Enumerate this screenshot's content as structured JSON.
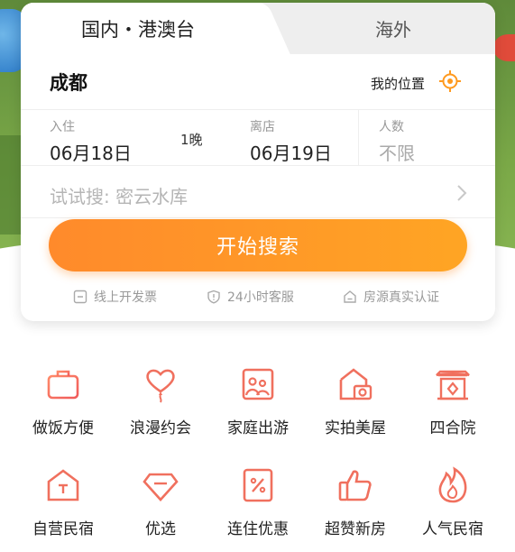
{
  "tabs": {
    "domestic": "国内・港澳台",
    "overseas": "海外"
  },
  "location": {
    "city": "成都",
    "my_location": "我的位置"
  },
  "dates": {
    "checkin_label": "入住",
    "checkin_value": "06月18日",
    "nights": "1晚",
    "checkout_label": "离店",
    "checkout_value": "06月19日",
    "guests_label": "人数",
    "guests_value": "不限"
  },
  "keyword": {
    "placeholder": "试试搜: 密云水库"
  },
  "search_button": "开始搜索",
  "features": [
    "线上开发票",
    "24小时客服",
    "房源真实认证"
  ],
  "categories": [
    {
      "label": "做饭方便",
      "icon": "cooking-pot-icon"
    },
    {
      "label": "浪漫约会",
      "icon": "heart-balloon-icon"
    },
    {
      "label": "家庭出游",
      "icon": "family-photo-icon"
    },
    {
      "label": "实拍美屋",
      "icon": "house-camera-icon"
    },
    {
      "label": "四合院",
      "icon": "courtyard-gate-icon"
    },
    {
      "label": "自营民宿",
      "icon": "self-run-house-icon"
    },
    {
      "label": "优选",
      "icon": "diamond-icon"
    },
    {
      "label": "连住优惠",
      "icon": "discount-coupon-icon"
    },
    {
      "label": "超赞新房",
      "icon": "thumbs-up-icon"
    },
    {
      "label": "人气民宿",
      "icon": "flame-icon"
    }
  ],
  "colors": {
    "accent": "#ff8a2b",
    "accent_end": "#ffa524",
    "icon": "#f0705e"
  }
}
